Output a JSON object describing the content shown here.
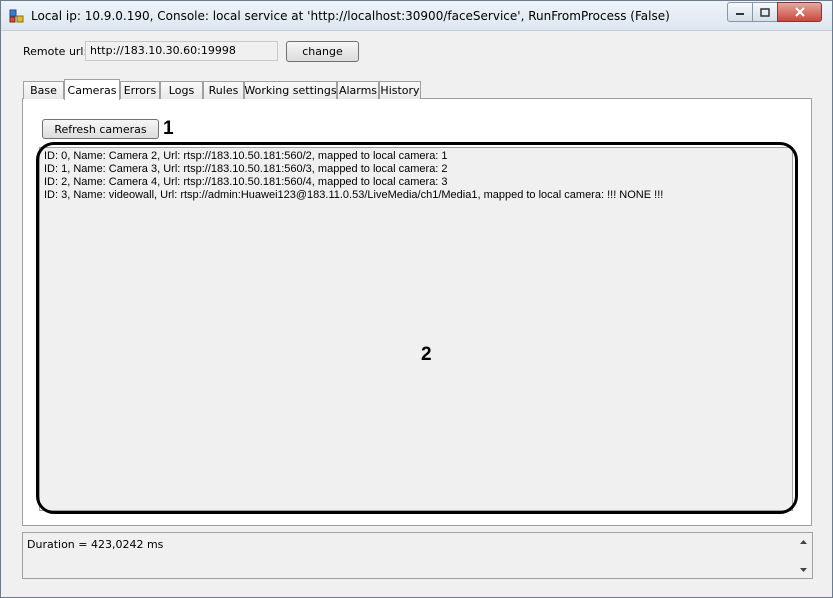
{
  "window": {
    "title": "Local ip: 10.9.0.190, Console: local service at 'http://localhost:30900/faceService', RunFromProcess (False)",
    "icons": {
      "app": "app-icon",
      "minimize": "minimize-icon",
      "maximize": "maximize-icon",
      "close": "close-icon"
    }
  },
  "remote": {
    "label": "Remote url:",
    "value": "http://183.10.30.60:19998",
    "change_label": "change"
  },
  "tabs": [
    {
      "label": "Base",
      "active": false
    },
    {
      "label": "Cameras",
      "active": true
    },
    {
      "label": "Errors",
      "active": false
    },
    {
      "label": "Logs",
      "active": false
    },
    {
      "label": "Rules",
      "active": false
    },
    {
      "label": "Working settings",
      "active": false
    },
    {
      "label": "Alarms",
      "active": false
    },
    {
      "label": "History",
      "active": false
    }
  ],
  "cameras": {
    "refresh_label": "Refresh cameras",
    "lines": [
      "ID: 0, Name: Camera 2, Url: rtsp://183.10.50.181:560/2, mapped to local camera: 1",
      "ID: 1, Name: Camera 3, Url: rtsp://183.10.50.181:560/3, mapped to local camera: 2",
      "ID: 2, Name: Camera 4, Url: rtsp://183.10.50.181:560/4, mapped to local camera: 3",
      "ID: 3, Name: videowall, Url: rtsp://admin:Huawei123@183.11.0.53/LiveMedia/ch1/Media1, mapped to local camera: !!! NONE !!!"
    ]
  },
  "annotations": {
    "callout_1": "1",
    "callout_2": "2"
  },
  "status": {
    "text": "Duration = 423,0242 ms"
  }
}
